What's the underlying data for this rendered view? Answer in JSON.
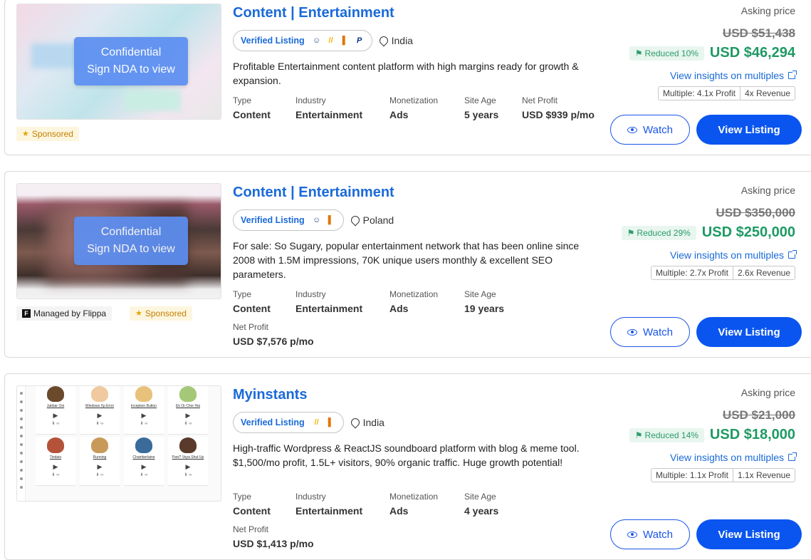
{
  "common": {
    "asking_label": "Asking price",
    "insights_label": "View insights on multiples",
    "multiple_prefix": "Multiple:",
    "watch_label": "Watch",
    "view_label": "View Listing",
    "verified_label": "Verified Listing",
    "nda_line1": "Confidential",
    "nda_line2": "Sign NDA to view",
    "sponsored_label": "Sponsored",
    "managed_label": "Managed by Flippa",
    "meta_keys": {
      "type": "Type",
      "industry": "Industry",
      "monetization": "Monetization",
      "age": "Site Age",
      "profit": "Net Profit"
    }
  },
  "listings": [
    {
      "title": "Content | Entertainment",
      "location": "India",
      "description": "Profitable Entertainment content platform with high margins ready for growth & expansion.",
      "type": "Content",
      "industry": "Entertainment",
      "monetization": "Ads",
      "age": "5 years",
      "profit": "USD $939 p/mo",
      "old_price": "USD $51,438",
      "reduced": "Reduced 10%",
      "price": "USD $46,294",
      "mult_profit": "4.1x Profit",
      "mult_revenue": "4x Revenue",
      "icons": [
        "people-icon",
        "google-ads-icon",
        "analytics-icon",
        "paypal-icon"
      ]
    },
    {
      "title": "Content | Entertainment",
      "location": "Poland",
      "description": "For sale: So Sugary, popular entertainment network that has been online since 2008 with 1.5M impressions, 70K unique users monthly & excellent SEO parameters.",
      "type": "Content",
      "industry": "Entertainment",
      "monetization": "Ads",
      "age": "19 years",
      "profit": "USD $7,576 p/mo",
      "old_price": "USD $350,000",
      "reduced": "Reduced 29%",
      "price": "USD $250,000",
      "mult_profit": "2.7x Profit",
      "mult_revenue": "2.6x Revenue",
      "icons": [
        "people-icon",
        "analytics-icon"
      ]
    },
    {
      "title": "Myinstants",
      "location": "India",
      "description": "High-traffic Wordpress & ReactJS soundboard platform with blog & meme tool. $1,500/mo profit, 1.5L+ visitors, 90% organic traffic. Huge growth potential!",
      "type": "Content",
      "industry": "Entertainment",
      "monetization": "Ads",
      "age": "4 years",
      "profit": "USD $1,413 p/mo",
      "old_price": "USD $21,000",
      "reduced": "Reduced 14%",
      "price": "USD $18,000",
      "mult_profit": "1.1x Profit",
      "mult_revenue": "1.1x Revenue",
      "icons": [
        "google-ads-icon",
        "analytics-icon"
      ],
      "thumb_tiles": [
        "Jabbar Ooi",
        "Windows Xp Error",
        "Inception Button",
        "Ek Or Chor Hai",
        "Tindaio",
        "Running",
        "Chamberlaine",
        "Pani? Vaya Shut Up"
      ]
    }
  ],
  "colors": {
    "link": "#1a6ad8",
    "price": "#1e9a63",
    "button": "#0a55f0"
  }
}
